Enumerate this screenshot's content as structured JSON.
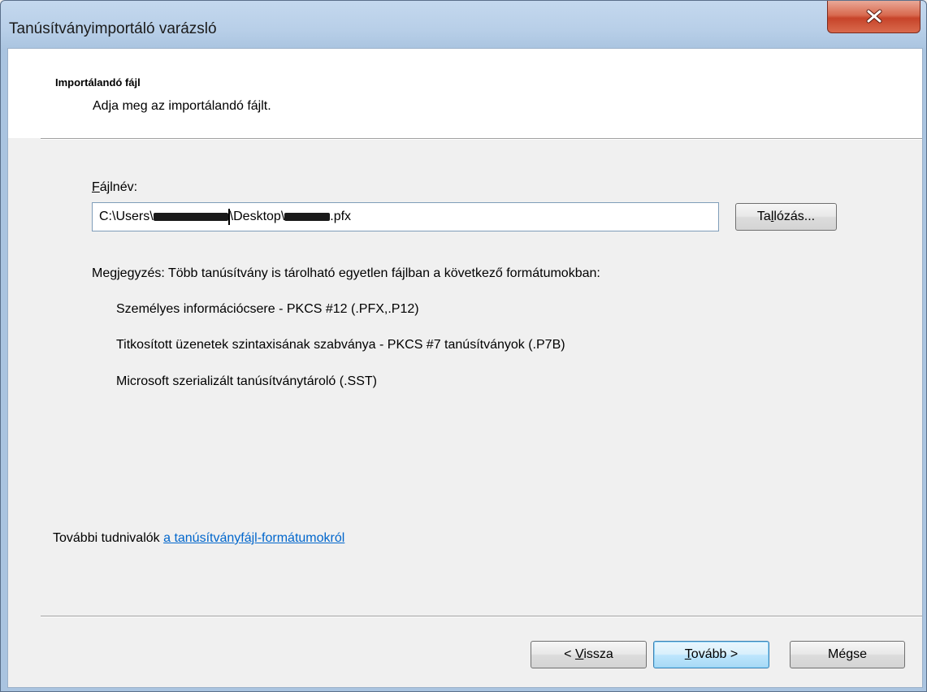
{
  "window": {
    "title": "Tanúsítványimportáló varázsló"
  },
  "header": {
    "title": "Importálandó fájl",
    "subtitle": "Adja meg az importálandó fájlt."
  },
  "filename": {
    "label_mnemonic": "F",
    "label_rest": "ájlnév:",
    "value_prefix": "C:\\Users\\",
    "value_mid": "\\Desktop\\",
    "value_suffix": ".pfx",
    "browse_pre": "Ta",
    "browse_mnemonic": "l",
    "browse_post": "lózás..."
  },
  "note": {
    "text": "Megjegyzés: Több tanúsítvány is tárolható egyetlen fájlban a következő formátumokban:",
    "formats": [
      "Személyes információcsere - PKCS #12 (.PFX,.P12)",
      "Titkosított üzenetek szintaxisának szabványa  - PKCS #7 tanúsítványok (.P7B)",
      "Microsoft szerializált tanúsítványtároló (.SST)"
    ]
  },
  "more_info": {
    "prefix": "További tudnivalók ",
    "link": "a tanúsítványfájl-formátumokról"
  },
  "buttons": {
    "back_pre": "< ",
    "back_mnemonic": "V",
    "back_post": "issza",
    "next_mnemonic": "T",
    "next_post": "ovább >",
    "cancel": "Mégse"
  },
  "colors": {
    "link": "#0066cc",
    "close_button": "#c7442a",
    "title_bar": "#b8cfe8"
  }
}
